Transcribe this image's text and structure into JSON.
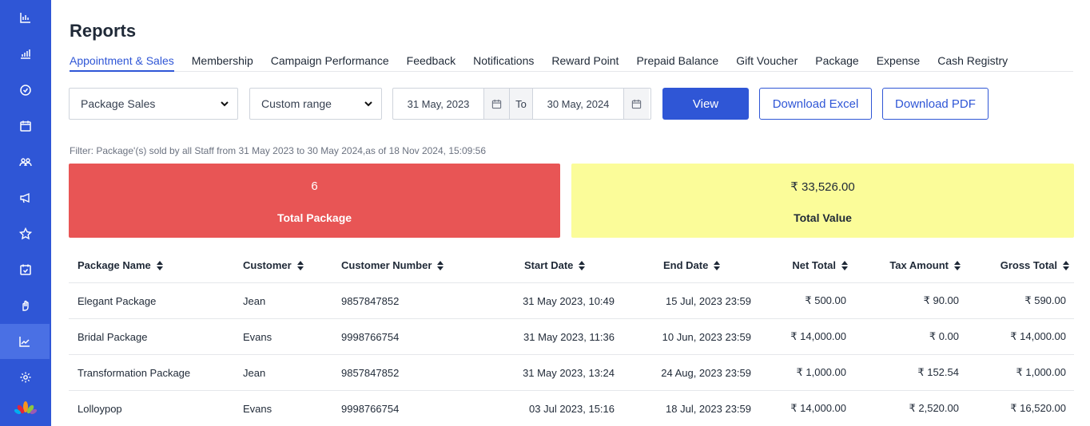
{
  "sidebar": {
    "items": [
      {
        "icon": "bar-chart-icon"
      },
      {
        "icon": "signal-bars-icon"
      },
      {
        "icon": "check-circle-icon"
      },
      {
        "icon": "calendar-icon"
      },
      {
        "icon": "users-icon"
      },
      {
        "icon": "megaphone-icon"
      },
      {
        "icon": "star-icon"
      },
      {
        "icon": "calendar-check-icon"
      },
      {
        "icon": "hand-icon"
      },
      {
        "icon": "trend-chart-icon",
        "active": true
      },
      {
        "icon": "settings-icon"
      }
    ],
    "logo": "lotus-logo-icon"
  },
  "page": {
    "title": "Reports"
  },
  "tabs": [
    {
      "label": "Appointment & Sales",
      "active": true
    },
    {
      "label": "Membership"
    },
    {
      "label": "Campaign Performance"
    },
    {
      "label": "Feedback"
    },
    {
      "label": "Notifications"
    },
    {
      "label": "Reward Point"
    },
    {
      "label": "Prepaid Balance"
    },
    {
      "label": "Gift Voucher"
    },
    {
      "label": "Package"
    },
    {
      "label": "Expense"
    },
    {
      "label": "Cash Registry"
    }
  ],
  "controls": {
    "report_type": "Package Sales",
    "range_type": "Custom range",
    "date_from": "31 May, 2023",
    "to_label": "To",
    "date_to": "30 May, 2024",
    "view_label": "View",
    "excel_label": "Download Excel",
    "pdf_label": "Download PDF"
  },
  "filter_text": "Filter: Package'(s) sold by all Staff from 31 May 2023 to 30 May 2024,as of 18 Nov 2024, 15:09:56",
  "summary": {
    "package_count": "6",
    "package_label": "Total Package",
    "total_value": "₹ 33,526.00",
    "value_label": "Total Value"
  },
  "table": {
    "columns": [
      "Package Name",
      "Customer",
      "Customer Number",
      "Start Date",
      "End Date",
      "Net Total",
      "Tax Amount",
      "Gross Total"
    ],
    "rows": [
      [
        "Elegant Package",
        "Jean",
        "9857847852",
        "31 May 2023, 10:49",
        "15 Jul, 2023 23:59",
        "₹ 500.00",
        "₹ 90.00",
        "₹ 590.00"
      ],
      [
        "Bridal Package",
        "Evans",
        "9998766754",
        "31 May 2023, 11:36",
        "10 Jun, 2023 23:59",
        "₹ 14,000.00",
        "₹ 0.00",
        "₹ 14,000.00"
      ],
      [
        "Transformation Package",
        "Jean",
        "9857847852",
        "31 May 2023, 13:24",
        "24 Aug, 2023 23:59",
        "₹ 1,000.00",
        "₹ 152.54",
        "₹ 1,000.00"
      ],
      [
        "Lolloypop",
        "Evans",
        "9998766754",
        "03 Jul 2023, 15:16",
        "18 Jul, 2023 23:59",
        "₹ 14,000.00",
        "₹ 2,520.00",
        "₹ 16,520.00"
      ]
    ]
  },
  "colors": {
    "brand": "#2f56d6",
    "card_red": "#e85555",
    "card_yellow": "#fbfc99"
  }
}
